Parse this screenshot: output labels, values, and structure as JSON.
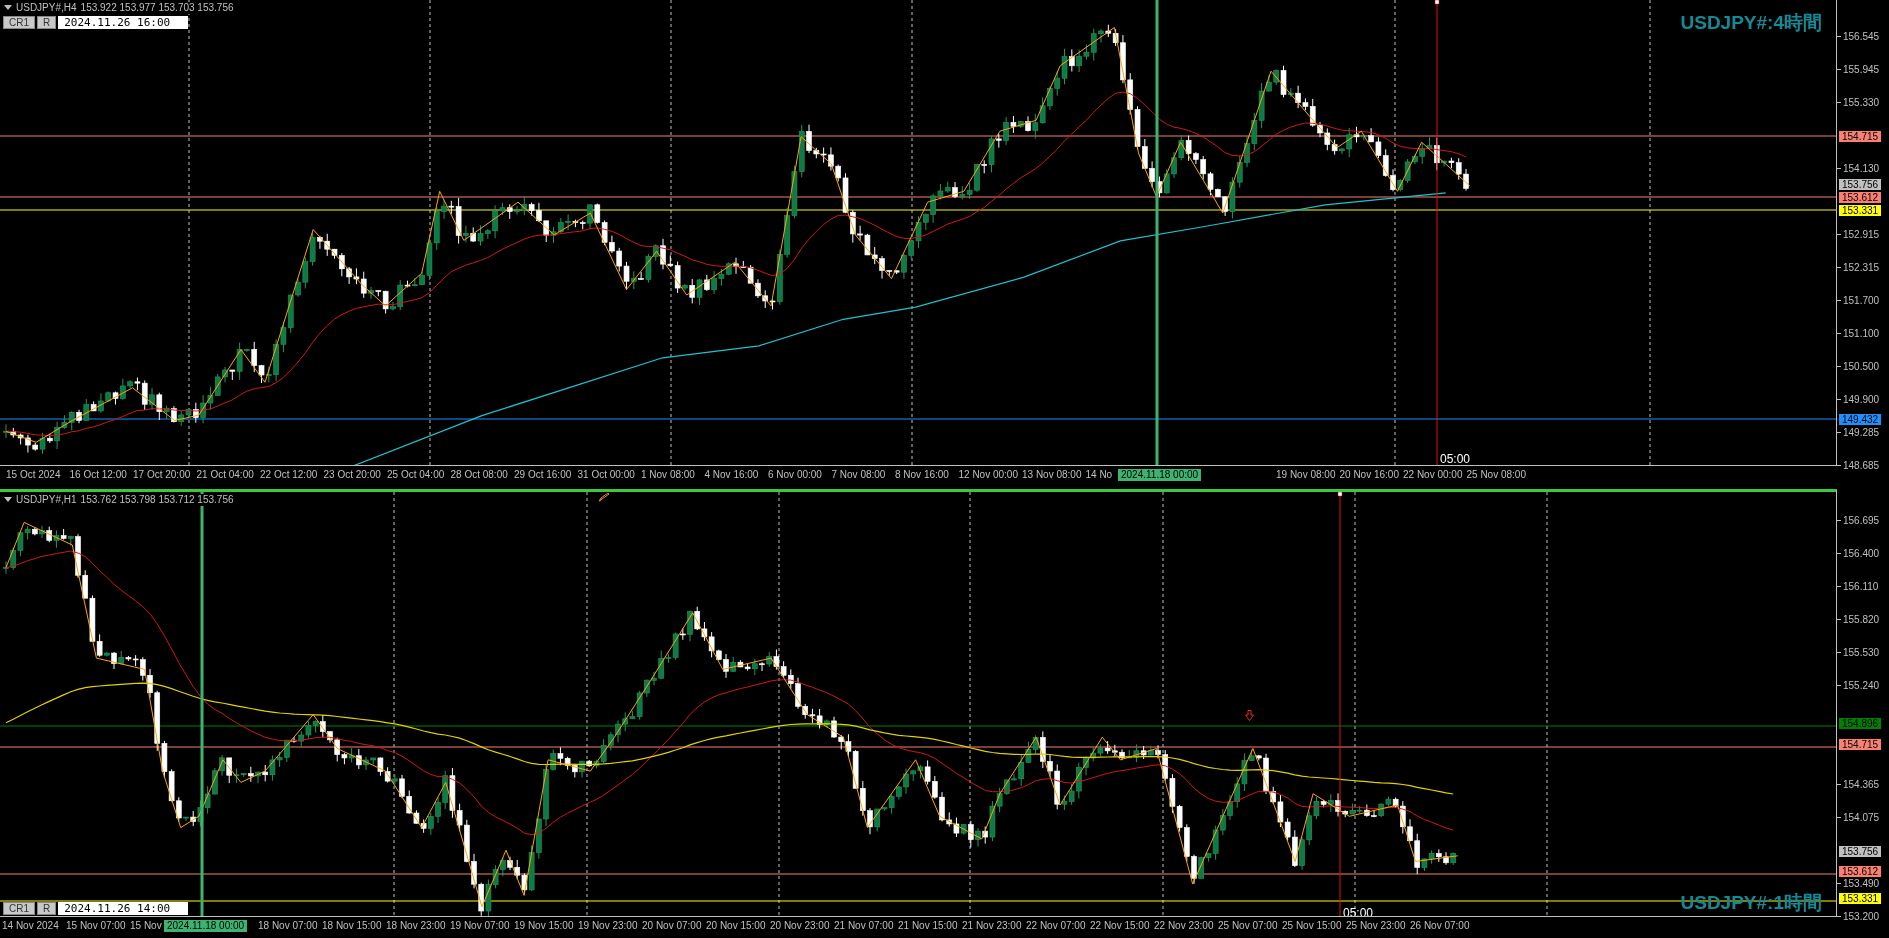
{
  "charts": [
    {
      "active": false,
      "header": {
        "symbol": "USDJPY#,H4",
        "ohlc": "153.922 153.977 153.703 153.756"
      },
      "controls": {
        "buttons": [
          "CR1",
          "R"
        ],
        "date": "2024.11.26 16:00"
      },
      "watermark": "USDJPY#:4時間",
      "price_ticks": [
        "156.545",
        "155.945",
        "155.330",
        "154.130",
        "152.915",
        "152.315",
        "151.700",
        "151.100",
        "150.500",
        "149.900",
        "149.285",
        "148.685"
      ],
      "price_tags": [
        {
          "label": "154.715",
          "kind": "level",
          "color": "#fa8072"
        },
        {
          "label": "153.756",
          "kind": "price",
          "color": "#c0c0c0"
        },
        {
          "label": "153.612",
          "kind": "level",
          "color": "#fa8072"
        },
        {
          "label": "153.331",
          "kind": "level",
          "color": "#ffff00"
        },
        {
          "label": "149.432",
          "kind": "level",
          "color": "#1e90ff"
        }
      ],
      "time_labels": [
        "15 Oct 2024",
        "16 Oct 12:00",
        "17 Oct 20:00",
        "21 Oct 04:00",
        "22 Oct 12:00",
        "23 Oct 20:00",
        "25 Oct 04:00",
        "28 Oct 08:00",
        "29 Oct 16:00",
        "31 Oct 00:00",
        "1 Nov 08:00",
        "4 Nov 16:00",
        "6 Nov 00:00",
        "7 Nov 08:00",
        "8 Nov 16:00",
        "12 Nov 00:00",
        "13 Nov 08:00",
        "14 No",
        "19 Nov 08:00",
        "20 Nov 16:00",
        "22 Nov 00:00",
        "25 Nov 08:00"
      ],
      "highlight_time": "2024.11.18 00:00",
      "crosshair_time": "05:00"
    },
    {
      "active": true,
      "header": {
        "symbol": "USDJPY#,H1",
        "ohlc": "153.762 153.798 153.712 153.756"
      },
      "controls": {
        "buttons": [
          "CR1",
          "R"
        ],
        "date": "2024.11.26 14:00"
      },
      "watermark": "USDJPY#:1時間",
      "price_ticks": [
        "156.695",
        "156.400",
        "156.110",
        "155.820",
        "155.530",
        "155.240",
        "154.365",
        "154.075",
        "153.490",
        "153.200"
      ],
      "price_tags": [
        {
          "label": "154.896",
          "kind": "level",
          "color": "#008000"
        },
        {
          "label": "154.715",
          "kind": "level",
          "color": "#fa8072"
        },
        {
          "label": "153.756",
          "kind": "price",
          "color": "#c0c0c0"
        },
        {
          "label": "153.612",
          "kind": "level",
          "color": "#fa8072"
        },
        {
          "label": "153.331",
          "kind": "level",
          "color": "#ffff00"
        }
      ],
      "time_labels": [
        "14 Nov 2024",
        "15 Nov 07:00",
        "15 Nov",
        "18 Nov 07:00",
        "18 Nov 15:00",
        "18 Nov 23:00",
        "19 Nov 07:00",
        "19 Nov 15:00",
        "19 Nov 23:00",
        "20 Nov 07:00",
        "20 Nov 15:00",
        "20 Nov 23:00",
        "21 Nov 07:00",
        "21 Nov 15:00",
        "21 Nov 23:00",
        "22 Nov 07:00",
        "22 Nov 15:00",
        "22 Nov 23:00",
        "25 Nov 07:00",
        "25 Nov 15:00",
        "25 Nov 23:00",
        "26 Nov 07:00"
      ],
      "highlight_time": "2024.11.18 00:00",
      "crosshair_time": "05:00"
    }
  ]
}
